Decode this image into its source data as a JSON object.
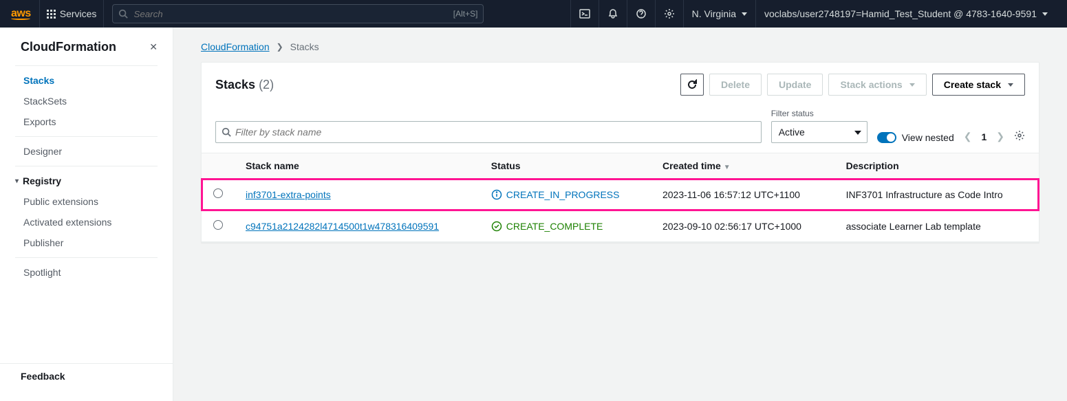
{
  "topnav": {
    "services_label": "Services",
    "search_placeholder": "Search",
    "search_shortcut": "[Alt+S]",
    "region": "N. Virginia",
    "user": "voclabs/user2748197=Hamid_Test_Student @ 4783-1640-9591"
  },
  "sidebar": {
    "title": "CloudFormation",
    "items": [
      "Stacks",
      "StackSets",
      "Exports"
    ],
    "designer": "Designer",
    "registry_label": "Registry",
    "registry_items": [
      "Public extensions",
      "Activated extensions",
      "Publisher"
    ],
    "spotlight": "Spotlight",
    "feedback": "Feedback"
  },
  "breadcrumb": {
    "root": "CloudFormation",
    "current": "Stacks"
  },
  "panel": {
    "title": "Stacks",
    "count": "(2)",
    "btn_delete": "Delete",
    "btn_update": "Update",
    "btn_stack_actions": "Stack actions",
    "btn_create": "Create stack",
    "filter_placeholder": "Filter by stack name",
    "filter_status_label": "Filter status",
    "filter_status_value": "Active",
    "view_nested": "View nested",
    "page_num": "1"
  },
  "table": {
    "headers": {
      "name": "Stack name",
      "status": "Status",
      "created": "Created time",
      "description": "Description"
    },
    "rows": [
      {
        "name": "inf3701-extra-points",
        "status_text": "CREATE_IN_PROGRESS",
        "status_kind": "progress",
        "created": "2023-11-06 16:57:12 UTC+1100",
        "description": "INF3701 Infrastructure as Code Intro",
        "highlighted": true
      },
      {
        "name": "c94751a2124282l4714500t1w478316409591",
        "status_text": "CREATE_COMPLETE",
        "status_kind": "complete",
        "created": "2023-09-10 02:56:17 UTC+1000",
        "description": "associate Learner Lab template",
        "highlighted": false
      }
    ]
  }
}
